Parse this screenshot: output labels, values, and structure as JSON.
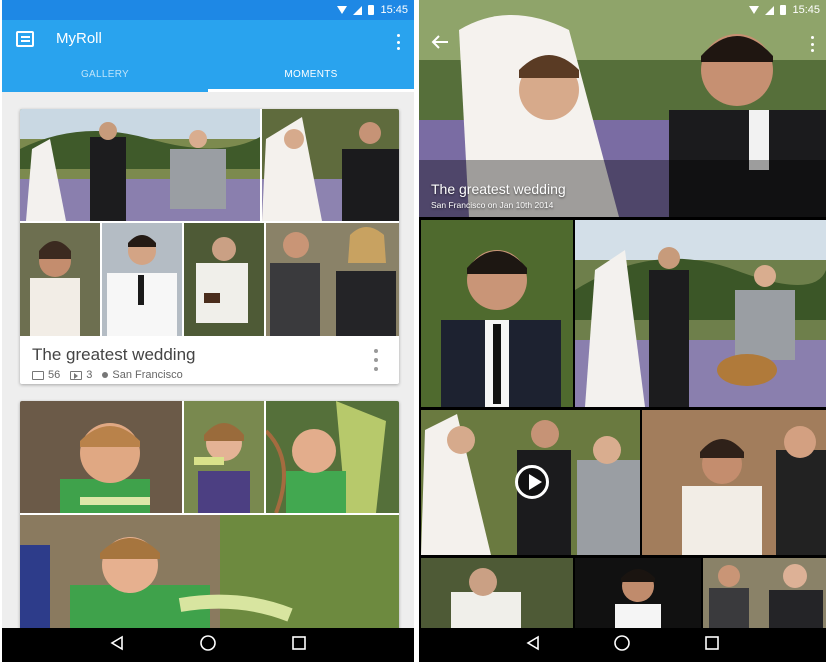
{
  "status": {
    "time": "15:45"
  },
  "gallery": {
    "app_title": "MyRoll",
    "tabs": [
      {
        "label": "GALLERY",
        "active": false
      },
      {
        "label": "MOMENTS",
        "active": true
      }
    ],
    "cards": [
      {
        "title": "The greatest wedding",
        "photo_count": "56",
        "video_count": "3",
        "location": "San Francisco"
      }
    ]
  },
  "detail": {
    "title": "The greatest wedding",
    "subtitle": "San Francisco on Jan 10th 2014"
  },
  "nav": {
    "icons": [
      "back-icon",
      "home-icon",
      "recents-icon"
    ]
  },
  "colors": {
    "status_bar": "#1e88e5",
    "app_bar": "#29a3ee"
  }
}
